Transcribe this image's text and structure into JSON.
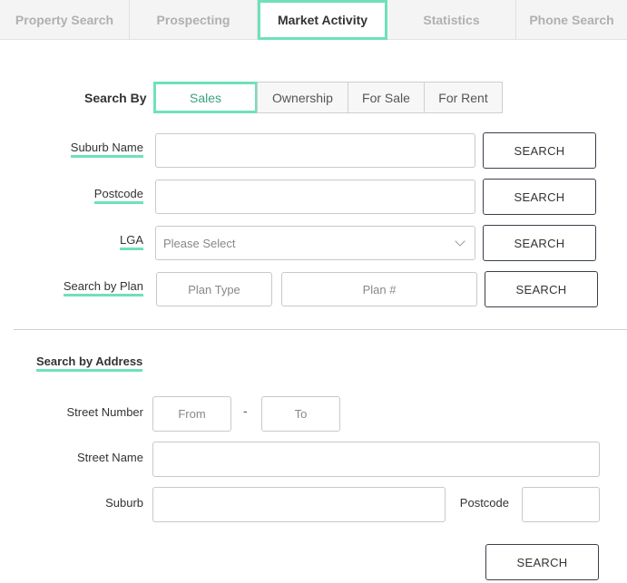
{
  "tabs": [
    {
      "label": "Property Search"
    },
    {
      "label": "Prospecting"
    },
    {
      "label": "Market Activity"
    },
    {
      "label": "Statistics"
    },
    {
      "label": "Phone Search"
    }
  ],
  "search_by": {
    "label": "Search By",
    "options": [
      {
        "label": "Sales"
      },
      {
        "label": "Ownership"
      },
      {
        "label": "For Sale"
      },
      {
        "label": "For Rent"
      }
    ],
    "selected": "Sales"
  },
  "rows": {
    "suburb_name": {
      "label": "Suburb Name",
      "value": "",
      "button": "SEARCH"
    },
    "postcode": {
      "label": "Postcode",
      "value": "",
      "button": "SEARCH"
    },
    "lga": {
      "label": "LGA",
      "selected": "Please Select",
      "button": "SEARCH"
    },
    "plan": {
      "label": "Search by Plan",
      "type_placeholder": "Plan Type",
      "number_placeholder": "Plan #",
      "button": "SEARCH"
    }
  },
  "address": {
    "heading": "Search by Address",
    "street_number_label": "Street Number",
    "from_placeholder": "From",
    "separator": "-",
    "to_placeholder": "To",
    "street_name_label": "Street Name",
    "suburb_label": "Suburb",
    "postcode_label": "Postcode",
    "button": "SEARCH"
  },
  "colors": {
    "accent": "#6fe1ba",
    "button_border": "#3a3f4a"
  }
}
